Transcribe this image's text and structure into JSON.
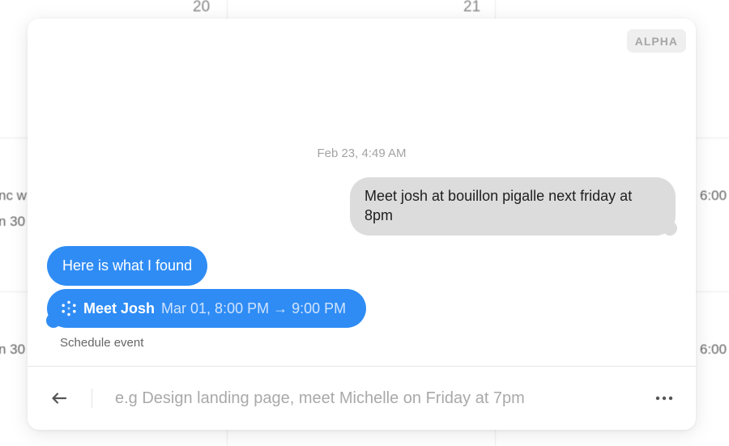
{
  "calendar": {
    "day_numbers": [
      "20",
      "21"
    ],
    "fragments": [
      "nc w",
      "n 30",
      "n 30",
      "6:00",
      "6:00"
    ]
  },
  "assistant": {
    "badge": "ALPHA",
    "timestamp": "Feb 23, 4:49 AM",
    "user_message": "Meet josh at bouillon pigalle next friday at 8pm",
    "bot_reply": "Here is what I found",
    "event": {
      "icon": "sparkle-dots-icon",
      "title": "Meet Josh",
      "time": "Mar 01, 8:00 PM → 9:00 PM"
    },
    "schedule_label": "Schedule event",
    "input": {
      "placeholder": "e.g Design landing page, meet Michelle on Friday at 7pm",
      "value": ""
    },
    "icons": {
      "back": "arrow-left-icon",
      "more": "more-horizontal-icon"
    },
    "colors": {
      "bot_bubble": "#2f8cf5",
      "user_bubble": "#dcdcdc"
    }
  }
}
